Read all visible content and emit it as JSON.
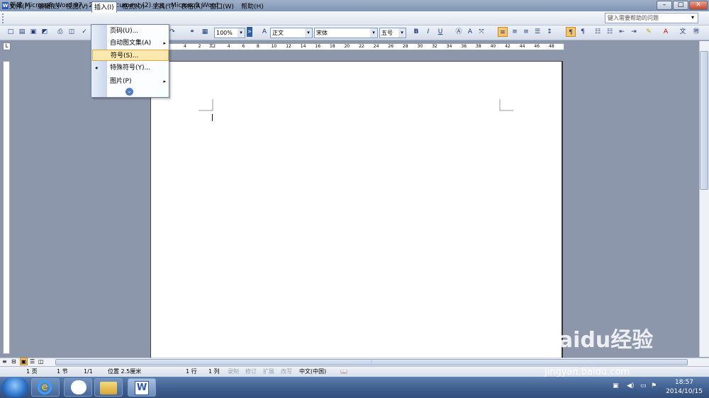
{
  "window": {
    "title": "新建 Microsoft Word 97 - 2003 Document (2).doc - Microsoft Word",
    "app_icon": "W",
    "minimize": "–",
    "maximize": "□",
    "close": "✕"
  },
  "menubar": {
    "items": [
      {
        "label": "文件(F)"
      },
      {
        "label": "编辑(E)"
      },
      {
        "label": "视图(V)"
      },
      {
        "label": "插入(I)"
      },
      {
        "label": "格式(O)"
      },
      {
        "label": "工具(T)"
      },
      {
        "label": "表格(A)"
      },
      {
        "label": "窗口(W)"
      },
      {
        "label": "帮助(H)"
      }
    ],
    "help_placeholder": "键入需要帮助的问题"
  },
  "insert_menu": {
    "items": [
      {
        "label": "页码(U)..."
      },
      {
        "label": "自动图文集(A)",
        "submenu": "▸"
      },
      {
        "label": "符号(S)..."
      },
      {
        "label": "特殊符号(Y)...",
        "icon": "•"
      },
      {
        "label": "图片(P)",
        "submenu": "▸"
      }
    ],
    "expand": "⌄"
  },
  "toolbar": {
    "zoom": "100%",
    "style": "正文",
    "font": "宋体",
    "size": "五号",
    "bold": "B",
    "italic": "I",
    "underline": "U",
    "font_color": "A"
  },
  "ruler": {
    "corner": "L",
    "ticks": [
      "4",
      "2",
      "2",
      "4",
      "6",
      "8",
      "10",
      "12",
      "14",
      "16",
      "18",
      "20",
      "22",
      "24",
      "26",
      "28",
      "30",
      "32",
      "34",
      "36",
      "38",
      "40",
      "42",
      "44",
      "46",
      "48"
    ]
  },
  "statusbar": {
    "page": "1 页",
    "section": "1 节",
    "page_of": "1/1",
    "position": "位置 2.5厘米",
    "line": "1 行",
    "column": "1 列",
    "rec": "录制",
    "trk": "修订",
    "ext": "扩展",
    "ovr": "改写",
    "language": "中文(中国)"
  },
  "taskbar": {
    "time": "18:57",
    "date": "2014/10/15"
  },
  "watermark": {
    "logo": "Baidu经验",
    "url": "jingyan.baidu.com"
  }
}
